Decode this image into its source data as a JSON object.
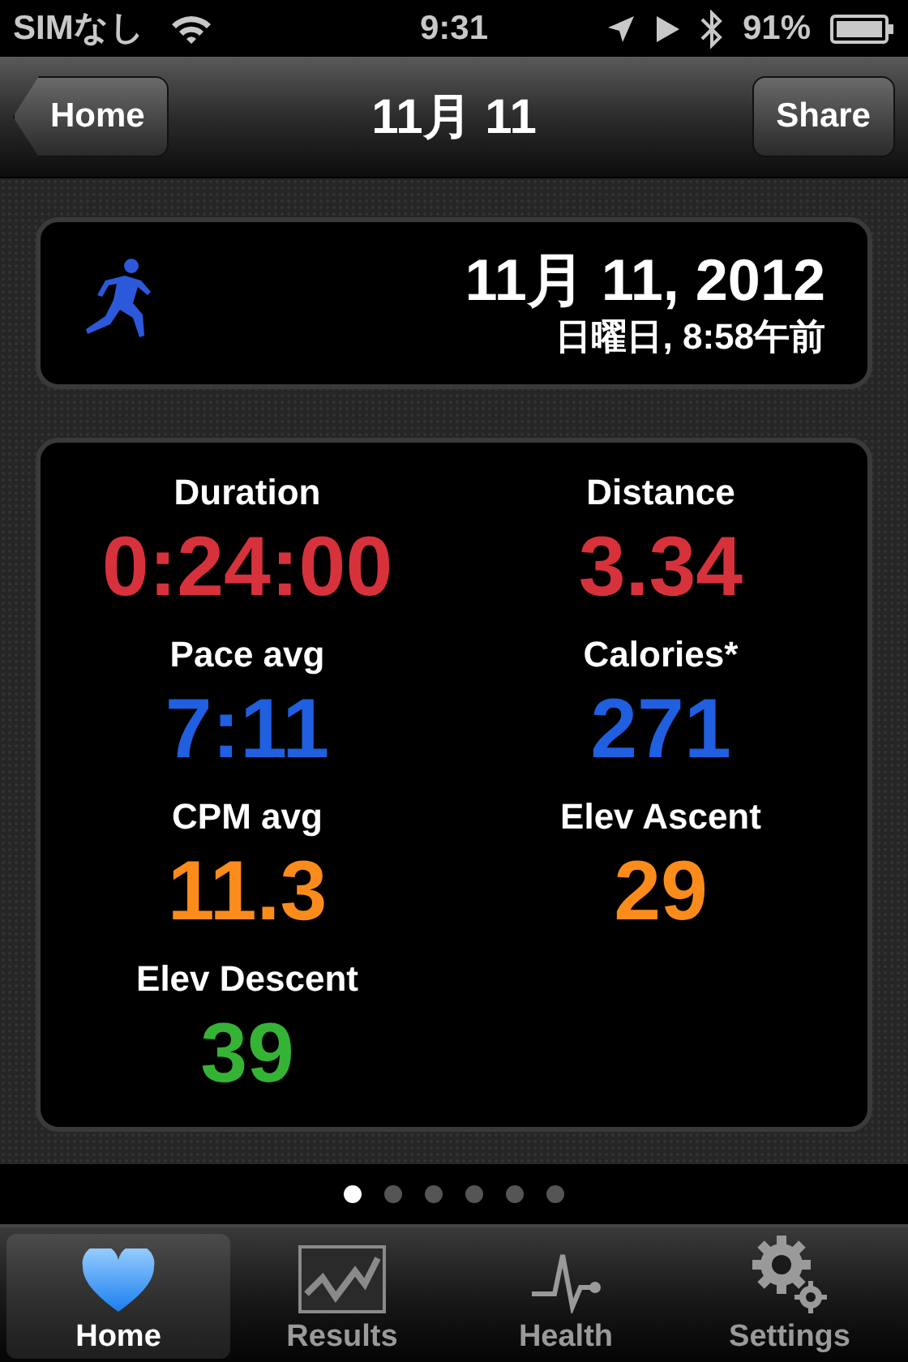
{
  "status_bar": {
    "carrier": "SIMなし",
    "time": "9:31",
    "battery": "91%"
  },
  "nav_bar": {
    "back": "Home",
    "title": "11月 11",
    "action": "Share"
  },
  "workout": {
    "date": "11月 11, 2012",
    "day_time": "日曜日, 8:58午前"
  },
  "stats": [
    {
      "label": "Duration",
      "value": "0:24:00",
      "color": "#d7323c"
    },
    {
      "label": "Distance",
      "value": "3.34",
      "color": "#d7323c"
    },
    {
      "label": "Pace avg",
      "value": "7:11",
      "color": "#1f5fe0"
    },
    {
      "label": "Calories*",
      "value": "271",
      "color": "#1f5fe0"
    },
    {
      "label": "CPM avg",
      "value": "11.3",
      "color": "#fb8c1c"
    },
    {
      "label": "Elev Ascent",
      "value": "29",
      "color": "#fb8c1c"
    },
    {
      "label": "Elev Descent",
      "value": "39",
      "color": "#35b335"
    }
  ],
  "page_dots": [
    {
      "selected": true
    },
    {
      "selected": false
    },
    {
      "selected": false
    },
    {
      "selected": false
    },
    {
      "selected": false
    },
    {
      "selected": false
    }
  ],
  "tabs": [
    {
      "kind": "heart",
      "label": "Home",
      "selected": true
    },
    {
      "kind": "chart",
      "label": "Results",
      "selected": false
    },
    {
      "kind": "pulse",
      "label": "Health",
      "selected": false
    },
    {
      "kind": "gears",
      "label": "Settings",
      "selected": false
    }
  ]
}
